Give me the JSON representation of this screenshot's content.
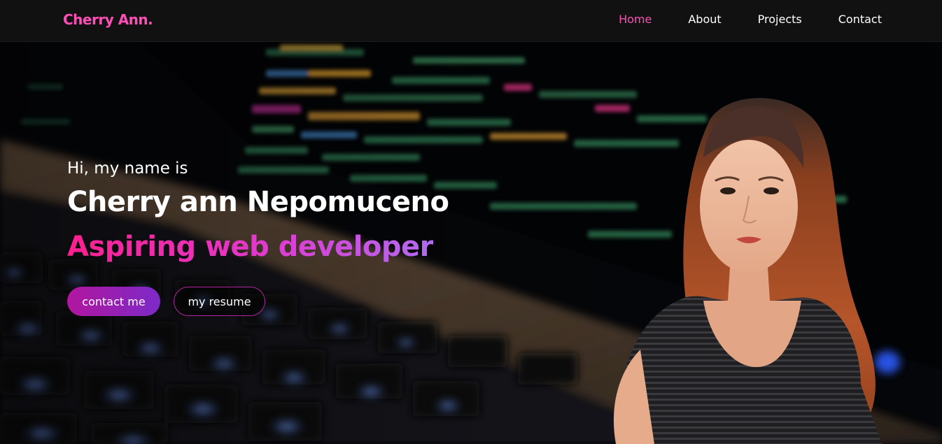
{
  "navbar": {
    "brand": "Cherry Ann.",
    "links": [
      {
        "label": "Home",
        "active": true
      },
      {
        "label": "About",
        "active": false
      },
      {
        "label": "Projects",
        "active": false
      },
      {
        "label": "Contact",
        "active": false
      }
    ]
  },
  "hero": {
    "intro": "Hi, my name is",
    "name": "Cherry ann Nepomuceno",
    "role": "Aspiring web developer",
    "buttons": {
      "primary": "contact me",
      "secondary": "my resume"
    }
  },
  "colors": {
    "accent": "#ff4fb7",
    "navbar_bg": "#111111",
    "button_gradient_start": "#b1169e",
    "button_gradient_end": "#7d2ac8"
  }
}
